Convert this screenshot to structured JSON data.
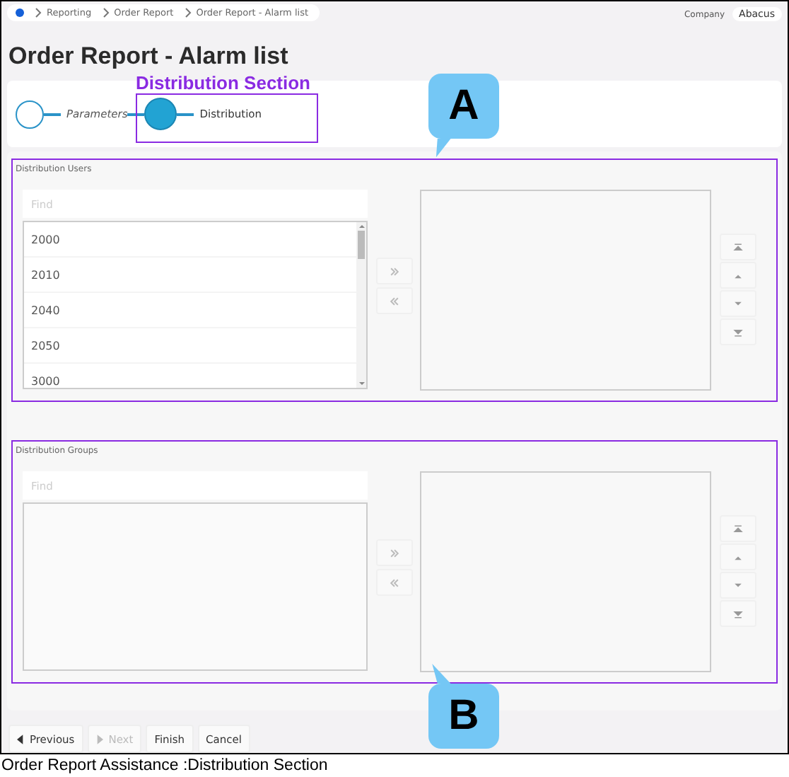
{
  "breadcrumb": [
    "Reporting",
    "Order Report",
    "Order Report - Alarm list"
  ],
  "company": {
    "label": "Company",
    "value": "Abacus"
  },
  "title": "Order Report - Alarm list",
  "annotation": "Distribution Section",
  "steps": [
    {
      "label": "Parameters",
      "selected": false
    },
    {
      "label": "Distribution",
      "selected": true
    }
  ],
  "sections": [
    {
      "title": "Distribution Users",
      "search": {
        "placeholder": "Find"
      },
      "items": [
        "2000",
        "2010",
        "2040",
        "2050",
        "3000"
      ]
    },
    {
      "title": "Distribution Groups",
      "search": {
        "placeholder": "Find"
      }
    }
  ],
  "footer_buttons": [
    {
      "label": "Previous",
      "kind": "previous",
      "disabled": false
    },
    {
      "label": "Next",
      "kind": "next",
      "disabled": true
    },
    {
      "label": "Finish",
      "kind": "plain",
      "disabled": false
    },
    {
      "label": "Cancel",
      "kind": "plain",
      "disabled": false
    }
  ],
  "callouts": [
    "A",
    "B"
  ],
  "caption": "Order Report Assistance :Distribution Section"
}
